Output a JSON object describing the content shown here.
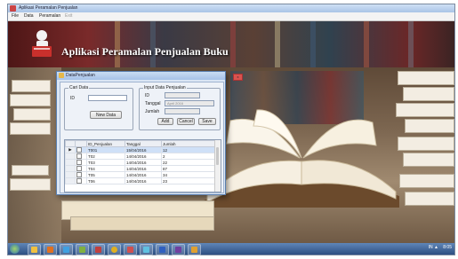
{
  "window": {
    "title": "Aplikasi Peramalan Penjualan"
  },
  "menu": [
    "File",
    "Data",
    "Peramalan",
    "Exit"
  ],
  "window_caps": {
    "minimize": "–",
    "maximize": "□",
    "close": "x"
  },
  "banner": {
    "title": "Aplikasi Peramalan Penjualan Buku"
  },
  "dialog": {
    "title": "DataPenjualan",
    "caps": {
      "minimize": "–",
      "maximize": "□",
      "close": "x"
    },
    "cari_data": {
      "legend": "Cari Data",
      "id_label": "ID",
      "id_value": "",
      "button": "New Data"
    },
    "input_data": {
      "legend": "Input Data Penjualan",
      "id_label": "ID",
      "id_value": "",
      "tanggal_label": "Tanggal",
      "tanggal_value": "April 2016",
      "jumlah_label": "Jumlah",
      "jumlah_value": "",
      "buttons": {
        "add": "Add",
        "cancel": "Cancel",
        "save": "Save"
      }
    },
    "table": {
      "headers": [
        "",
        "",
        "ID_Penjualan",
        "Tanggal",
        "Jumlah"
      ],
      "rows": [
        {
          "pointer": "▶",
          "id": "T001",
          "tanggal": "15/04/2016",
          "jumlah": "12"
        },
        {
          "pointer": "",
          "id": "T02",
          "tanggal": "14/04/2016",
          "jumlah": "2"
        },
        {
          "pointer": "",
          "id": "T03",
          "tanggal": "14/04/2016",
          "jumlah": "22"
        },
        {
          "pointer": "",
          "id": "T04",
          "tanggal": "14/04/2016",
          "jumlah": "87"
        },
        {
          "pointer": "",
          "id": "T05",
          "tanggal": "14/04/2016",
          "jumlah": "34"
        },
        {
          "pointer": "",
          "id": "T06",
          "tanggal": "14/04/2016",
          "jumlah": "23"
        }
      ]
    }
  },
  "taskbar": {
    "tray_text": "IN ▲",
    "clock": "8:05"
  },
  "colors": {
    "titlebar": "#a9c4e6",
    "taskbar": "#2d4f82",
    "dialog_bg": "#dbe6f5"
  }
}
